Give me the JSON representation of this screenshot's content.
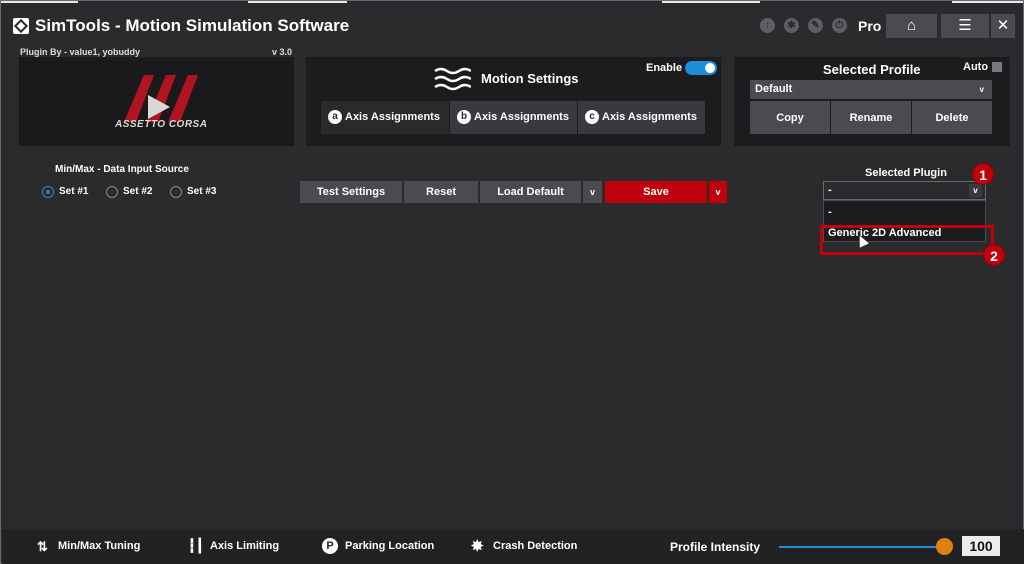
{
  "app": {
    "title": "SimTools - Motion Simulation Software",
    "pro_label": "Pro"
  },
  "titlebar": {
    "icons": [
      "up-arrow-icon",
      "gear-icon",
      "wrench-icon",
      "power-icon"
    ],
    "home_glyph": "⌂",
    "menu_glyph": "☰",
    "close_glyph": "✕"
  },
  "plugin_banner": {
    "plugin_by": "Plugin By - value1, yobuddy",
    "version": "v 3.0",
    "game_label": "ASSETTO CORSA"
  },
  "motion_settings": {
    "title": "Motion Settings",
    "enable_label": "Enable",
    "enabled": true,
    "tabs": [
      {
        "badge": "a",
        "label": "Axis Assignments"
      },
      {
        "badge": "b",
        "label": "Axis Assignments"
      },
      {
        "badge": "c",
        "label": "Axis Assignments"
      }
    ]
  },
  "profile": {
    "title": "Selected Profile",
    "auto_label": "Auto",
    "selected": "Default",
    "chevron": "v",
    "buttons": {
      "copy": "Copy",
      "rename": "Rename",
      "delete": "Delete"
    }
  },
  "input_source": {
    "title": "Min/Max - Data Input Source",
    "options": [
      "Set #1",
      "Set #2",
      "Set #3"
    ],
    "selected": "Set #1"
  },
  "actions": {
    "test": "Test Settings",
    "reset": "Reset",
    "load_default": "Load Default",
    "chevron": "v",
    "save": "Save",
    "save_chevron": "v"
  },
  "plugin": {
    "label": "Selected Plugin",
    "selected": "-",
    "chevron": "v",
    "options": [
      "-",
      "Generic 2D Advanced"
    ]
  },
  "annotations": {
    "step1": "1",
    "step2": "2"
  },
  "bottombar": {
    "items": [
      {
        "icon": "updown-arrows-icon",
        "label": "Min/Max Tuning"
      },
      {
        "icon": "axis-limit-icon",
        "label": "Axis Limiting"
      },
      {
        "icon": "parking-icon",
        "label": "Parking Location"
      },
      {
        "icon": "crash-icon",
        "label": "Crash Detection"
      }
    ],
    "intensity_label": "Profile Intensity",
    "intensity_value": "100",
    "intensity_fraction": 0.97
  },
  "colors": {
    "accent": "#1e8ed6",
    "save_red": "#c0000c",
    "slider_thumb": "#e0810d"
  }
}
